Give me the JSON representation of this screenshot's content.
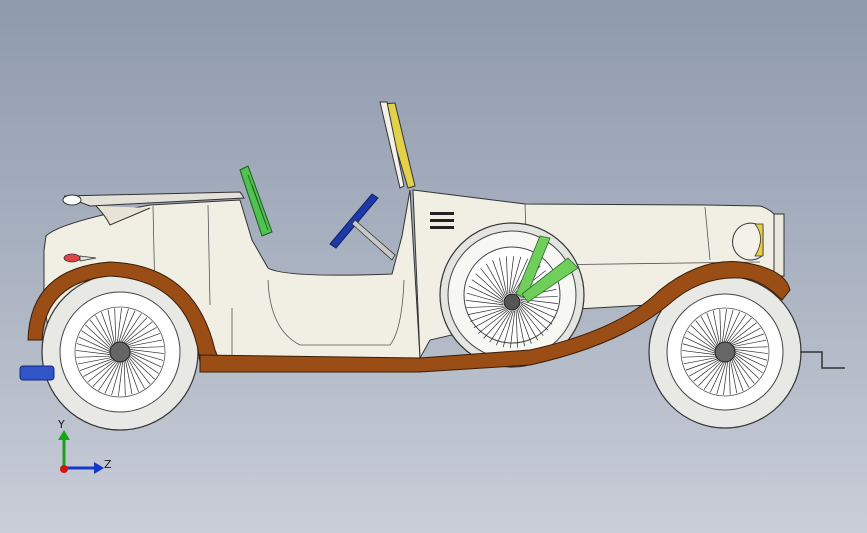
{
  "viewport": {
    "background_top": "#8f9aad",
    "background_bottom": "#c9ced8",
    "model_subject": "vintage-roadster-side-view"
  },
  "triad": {
    "y_label": "Y",
    "z_label": "Z",
    "y_color": "#1aa21a",
    "z_color": "#1438c8",
    "x_color": "#d41414"
  },
  "colors": {
    "body": "#f1efe4",
    "fender": "#9a4e16",
    "tire": "#f2f2f0",
    "spokes": "#2b2b2b",
    "seat": "#4fc24f",
    "windshield_frame": "#e3d14a",
    "steering": "#1e3aa8",
    "lamp": "#e6cf45",
    "tow_hook": "#2f55c8"
  }
}
